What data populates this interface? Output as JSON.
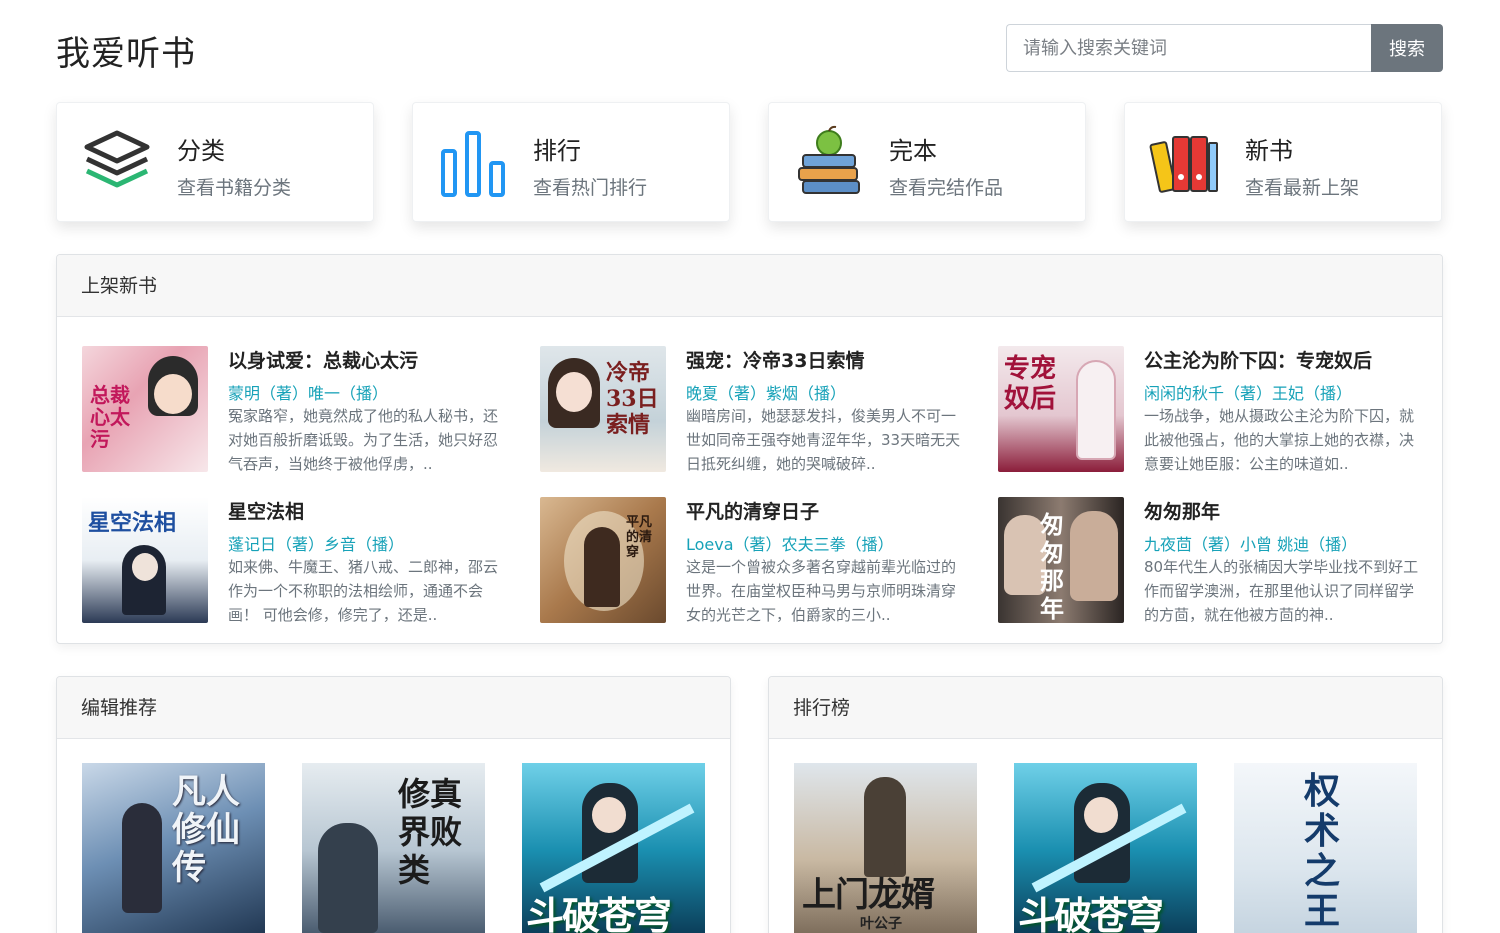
{
  "site": {
    "title": "我爱听书"
  },
  "search": {
    "placeholder": "请输入搜索关键词",
    "button_label": "搜索"
  },
  "nav_cards": [
    {
      "title": "分类",
      "subtitle": "查看书籍分类",
      "icon": "layers-icon"
    },
    {
      "title": "排行",
      "subtitle": "查看热门排行",
      "icon": "bar-chart-icon"
    },
    {
      "title": "完本",
      "subtitle": "查看完结作品",
      "icon": "books-apple-icon"
    },
    {
      "title": "新书",
      "subtitle": "查看最新上架",
      "icon": "binders-icon"
    }
  ],
  "new_books": {
    "header": "上架新书",
    "items": [
      {
        "title": "以身试爱：总裁心太污",
        "author": "蒙明",
        "narrator": "唯一",
        "author_tag": "（著）",
        "narrator_tag": "（播）",
        "desc": "冤家路窄，她竟然成了他的私人秘书，还对她百般折磨诋毁。为了生活，她只好忍气吞声，当她终于被他俘虏，..",
        "cover_text": "总裁心太污"
      },
      {
        "title": "强宠：冷帝33日索情",
        "author": "晚夏",
        "narrator": "紫烟",
        "author_tag": "（著）",
        "narrator_tag": "（播）",
        "desc": "幽暗房间，她瑟瑟发抖，俊美男人不可一世如同帝王强夺她青涩年华，33天暗无天日抵死纠缠，她的哭喊破碎..",
        "cover_text": "冷帝33日索情"
      },
      {
        "title": "公主沦为阶下囚：专宠奴后",
        "author": "闲闲的秋千",
        "narrator": "王妃",
        "author_tag": "（著）",
        "narrator_tag": "（播）",
        "desc": "一场战争，她从摄政公主沦为阶下囚，就此被他强占，他的大掌掠上她的衣襟，决意要让她臣服：公主的味道如..",
        "cover_text": "专宠奴后"
      },
      {
        "title": "星空法相",
        "author": "蓬记日",
        "narrator": "乡音",
        "author_tag": "（著）",
        "narrator_tag": "（播）",
        "desc": "如来佛、牛魔王、猪八戒、二郎神，邵云作为一个不称职的法相绘师，通通不会画！ 可他会修，修完了，还是..",
        "cover_text": "星空法相"
      },
      {
        "title": "平凡的清穿日子",
        "author": "Loeva",
        "narrator": "农夫三拳",
        "author_tag": "（著）",
        "narrator_tag": "（播）",
        "desc": "这是一个曾被众多著名穿越前辈光临过的世界。在庙堂权臣种马男与京师明珠清穿女的光芒之下，伯爵家的三小..",
        "cover_text": "平凡的清穿"
      },
      {
        "title": "匆匆那年",
        "author": "九夜茴",
        "narrator": "小曾 姚迪",
        "author_tag": "（著）",
        "narrator_tag": "（播）",
        "desc": "80年代生人的张楠因大学毕业找不到好工作而留学澳洲，在那里他认识了同样留学的方茴，就在他被方茴的神..",
        "cover_text": "匆匆那年"
      }
    ]
  },
  "editor_picks": {
    "header": "编辑推荐",
    "items": [
      {
        "cover_text": "凡人修仙传"
      },
      {
        "cover_text": "修真界败类"
      },
      {
        "cover_text": "斗破苍穹"
      }
    ]
  },
  "ranking": {
    "header": "排行榜",
    "items": [
      {
        "cover_text": "上门龙婿",
        "cover_sub": "叶公子"
      },
      {
        "cover_text": "斗破苍穹"
      },
      {
        "cover_text": "权术之王"
      }
    ]
  }
}
